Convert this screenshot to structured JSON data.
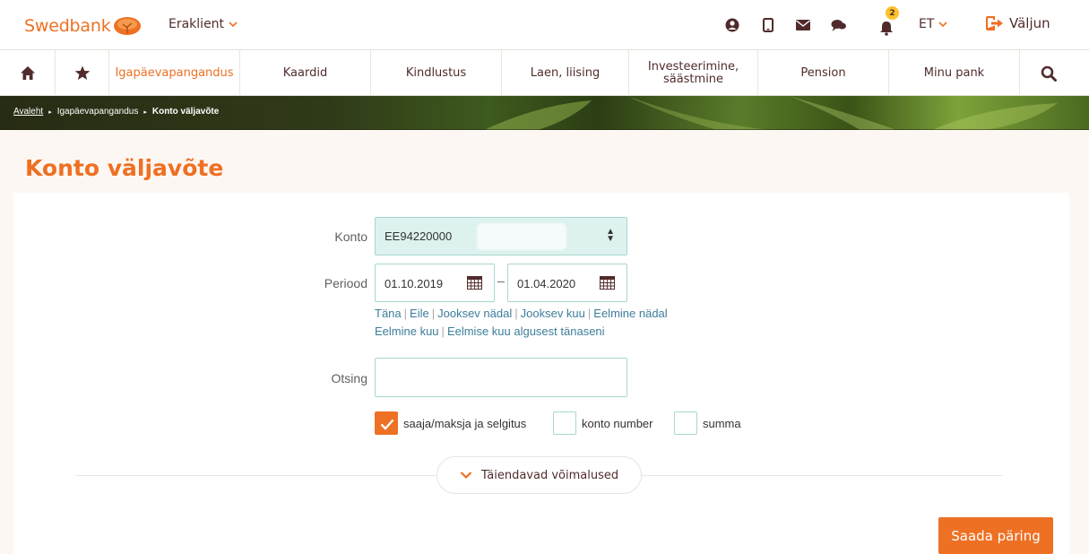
{
  "header": {
    "brand": "Swedbank",
    "segment": "Eraklient",
    "notifications_count": "2",
    "language": "ET",
    "logout_label": "Väljun",
    "icons": [
      "user-circle-icon",
      "mobile-icon",
      "envelope-icon",
      "chat-icon",
      "bell-icon"
    ]
  },
  "nav": {
    "items": [
      {
        "label": "",
        "icon": "home-icon"
      },
      {
        "label": "",
        "icon": "star-icon"
      },
      {
        "label": "Igapäevapangandus",
        "active": true
      },
      {
        "label": "Kaardid"
      },
      {
        "label": "Kindlustus"
      },
      {
        "label": "Laen, liising"
      },
      {
        "label": "Investeerimine, säästmine"
      },
      {
        "label": "Pension"
      },
      {
        "label": "Minu pank"
      },
      {
        "label": "",
        "icon": "search-icon"
      }
    ]
  },
  "breadcrumb": {
    "home": "Avaleht",
    "section": "Igapäevapangandus",
    "current": "Konto väljavõte"
  },
  "page": {
    "title": "Konto väljavõte"
  },
  "form": {
    "account_label": "Konto",
    "account_value": "EE94220000",
    "period_label": "Periood",
    "date_from": "01.10.2019",
    "date_to": "01.04.2020",
    "date_separator": "–",
    "quick_periods_row1": [
      "Täna",
      "Eile",
      "Jooksev nädal",
      "Jooksev kuu",
      "Eelmine nädal"
    ],
    "quick_periods_row2": [
      "Eelmine kuu",
      "Eelmise kuu algusest tänaseni"
    ],
    "search_label": "Otsing",
    "search_value": "",
    "checkboxes": [
      {
        "label": "saaja/maksja ja selgitus",
        "checked": true
      },
      {
        "label": "konto number",
        "checked": false
      },
      {
        "label": "summa",
        "checked": false
      }
    ],
    "more_options_label": "Täiendavad võimalused",
    "submit_label": "Saada päring"
  },
  "colors": {
    "brand_orange": "#ee7023",
    "text_brown": "#512b2b",
    "link_blue": "#3d7e9a",
    "field_border": "#a6d8d0",
    "badge_yellow": "#fdc129"
  }
}
